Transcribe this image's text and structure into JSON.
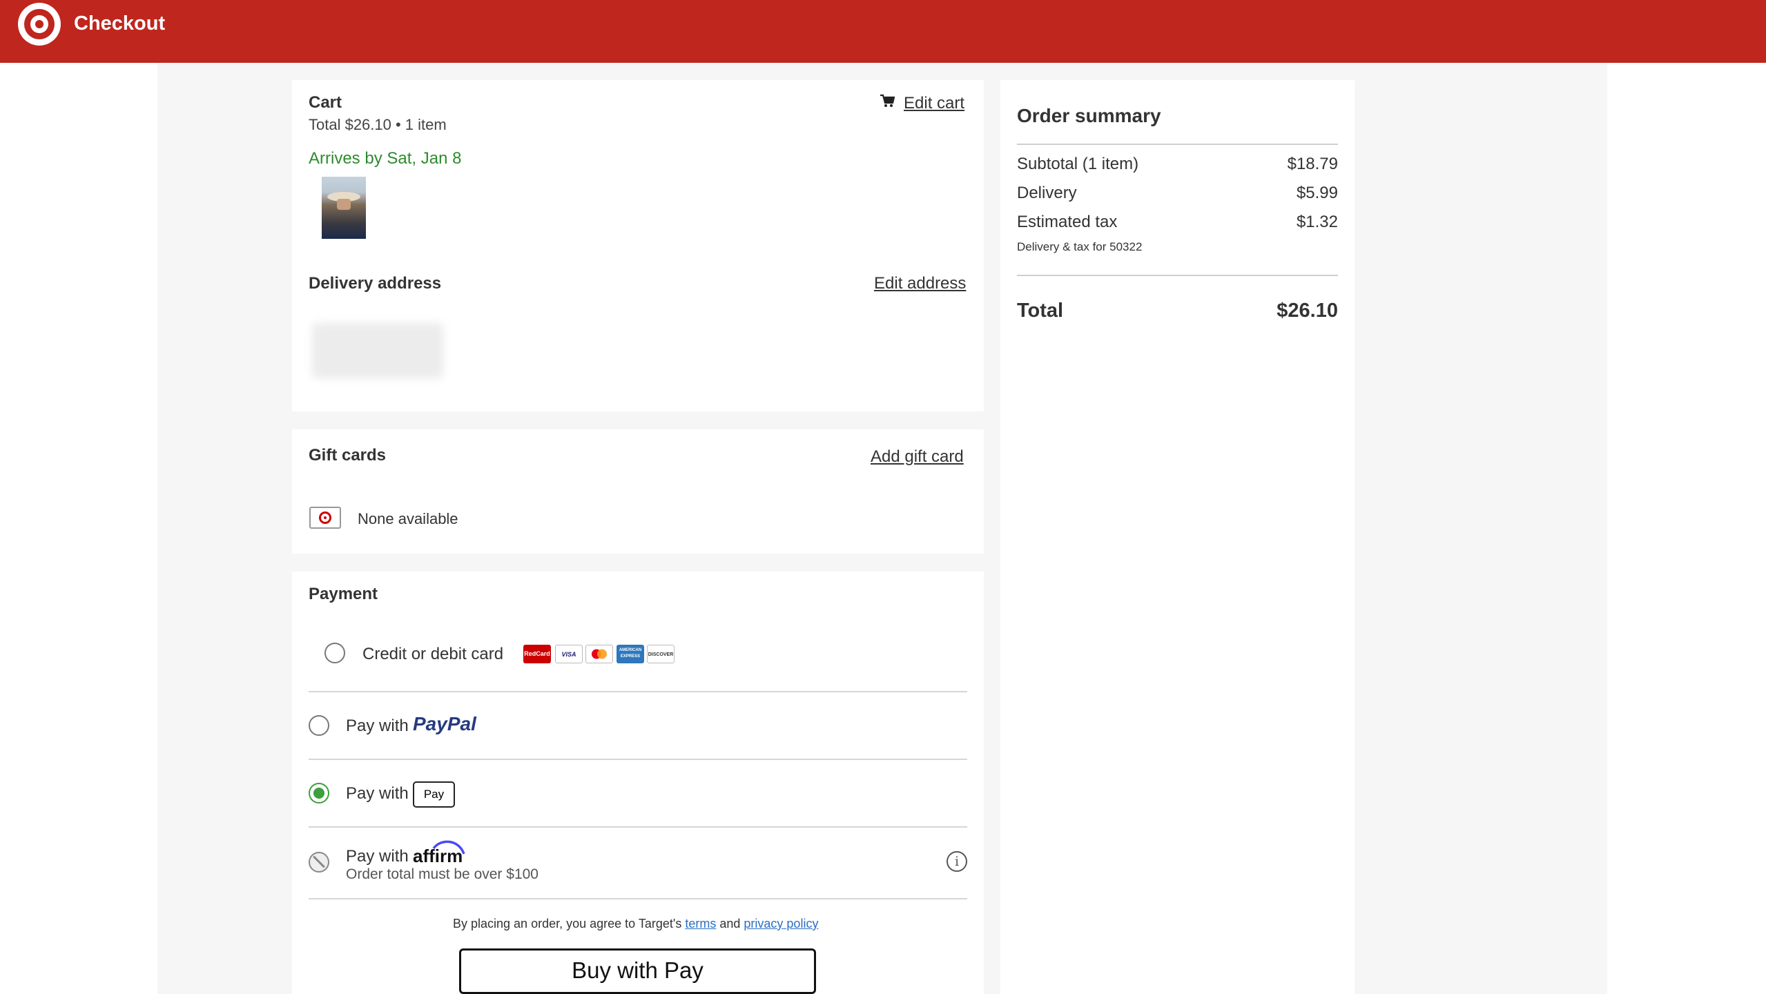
{
  "header": {
    "title": "Checkout",
    "logo": "target-bullseye-logo",
    "color": "#bf261e"
  },
  "cart": {
    "title": "Cart",
    "summary": "Total $26.10 • 1 item",
    "edit_label": "Edit cart",
    "arrival": "Arrives by Sat, Jan 8",
    "arrival_color": "#2e8b2e"
  },
  "delivery": {
    "title": "Delivery address",
    "edit_label": "Edit address"
  },
  "gift_cards": {
    "title": "Gift cards",
    "add_label": "Add gift card",
    "status": "None available"
  },
  "payment": {
    "title": "Payment",
    "options": [
      {
        "label": "Credit or debit card",
        "selected": false
      },
      {
        "label": "Pay with",
        "brand": "PayPal",
        "selected": false
      },
      {
        "label": "Pay with",
        "brand": "Pay",
        "selected": true
      },
      {
        "label": "Pay with",
        "brand": "affirm",
        "note": "Order total must be over $100",
        "disabled": true
      }
    ],
    "card_brands": [
      "RedCard",
      "VISA",
      "Mastercard",
      "AMERICAN EXPRESS",
      "DISCOVER"
    ],
    "selected_color": "#3d9f3d"
  },
  "legal": {
    "prefix": "By placing an order, you agree to Target's",
    "terms": "terms",
    "and": "and",
    "privacy": "privacy policy"
  },
  "buy_button": {
    "label_prefix": "Buy with",
    "apple_glyph": "",
    "label_suffix": "Pay"
  },
  "order_summary": {
    "title": "Order summary",
    "rows": [
      {
        "label": "Subtotal (1 item)",
        "value": "$18.79"
      },
      {
        "label": "Delivery",
        "value": "$5.99"
      },
      {
        "label": "Estimated tax",
        "value": "$1.32"
      }
    ],
    "tax_note": "Delivery & tax for 50322",
    "total_label": "Total",
    "total_value": "$26.10"
  }
}
